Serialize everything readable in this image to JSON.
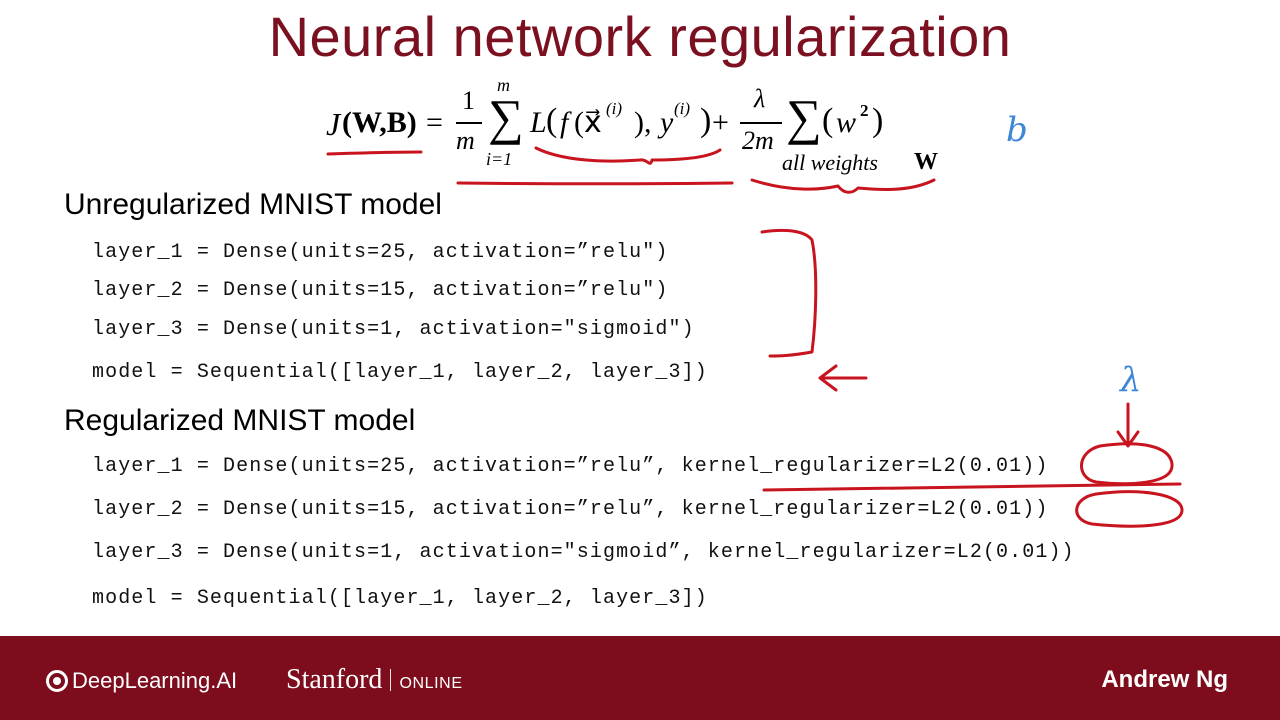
{
  "slide": {
    "title": "Neural network regularization"
  },
  "formula": {
    "J": "J",
    "args": "(W,B)",
    "equals": "=",
    "frac1_num": "1",
    "frac1_den": "m",
    "sum1_top": "m",
    "sum1_sym": "∑",
    "sum1_bottom": "i=1",
    "loss": "L",
    "loss_open": "(",
    "f": "f",
    "f_arg": "(x⃗",
    "sup_i1": "(i)",
    "f_close": "),",
    "y": "y",
    "sup_i2": "(i)",
    "loss_close": ")",
    "plus": "+",
    "frac2_num": "λ",
    "frac2_den": "2m",
    "sum2_sym": "∑",
    "sum2_bottom_text": "all weights",
    "sum2_bottom_bold": "W",
    "w_open": "(",
    "w": "w",
    "w_exp": "2",
    "w_close": ")"
  },
  "annotations": {
    "b_note": "b",
    "lambda_note": "λ"
  },
  "unregularized": {
    "heading": "Unregularized MNIST model",
    "lines": [
      "layer_1 = Dense(units=25, activation=”relu\")",
      "layer_2 = Dense(units=15, activation=”relu\")",
      "layer_3 = Dense(units=1, activation=\"sigmoid\")",
      "model = Sequential([layer_1, layer_2, layer_3])"
    ]
  },
  "regularized": {
    "heading": "Regularized MNIST model",
    "lines": [
      "layer_1 = Dense(units=25, activation=”relu”, kernel_regularizer=L2(0.01))",
      "layer_2 = Dense(units=15, activation=”relu”, kernel_regularizer=L2(0.01))",
      "layer_3 = Dense(units=1, activation=\"sigmoid”, kernel_regularizer=L2(0.01))",
      "model = Sequential([layer_1, layer_2, layer_3])"
    ]
  },
  "footer": {
    "deeplearning_logo": "DeepLearning.AI",
    "stanford_word": "Stanford",
    "stanford_online": "ONLINE",
    "presenter": "Andrew Ng"
  },
  "colors": {
    "title": "#7b1020",
    "ink_red": "#c8141e",
    "ink_blue": "#3e86d8",
    "footer_bg": "#7d0c1c"
  }
}
